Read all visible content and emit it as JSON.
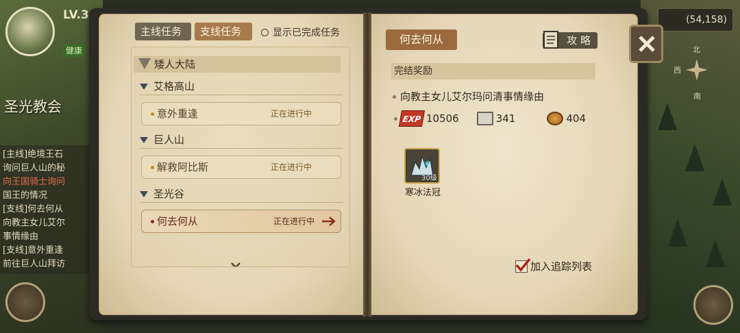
{
  "hud": {
    "level": "LV.3",
    "health_tag": "健康",
    "location_name": "圣光教会",
    "coords": "(54,158)",
    "compass": {
      "north": "北",
      "west": "西",
      "south": "南"
    },
    "quest_log": [
      "[主线]绝境王石",
      "询问巨人山的秘",
      "向王国骑士询问",
      "国王的情况",
      "[支线]何去何从",
      "向教主女儿艾尔",
      "事情缘由",
      "[支线]意外重逢",
      "前往巨人山拜访"
    ]
  },
  "tabs": {
    "main": "主线任务",
    "branch": "支线任务",
    "show_completed": "显示已完成任务"
  },
  "quests": {
    "region": "矮人大陆",
    "areas": [
      {
        "name": "艾格高山",
        "quest": "意外重逢",
        "status": "正在进行中"
      },
      {
        "name": "巨人山",
        "quest": "解救阿比斯",
        "status": "正在进行中"
      },
      {
        "name": "圣光谷",
        "quest": "何去何从",
        "status": "正在进行中"
      }
    ]
  },
  "detail": {
    "title": "何去何从",
    "guide_label": "攻 略",
    "reward_header": "完结奖励",
    "description": "向教主女儿艾尔玛问清事情缘由",
    "exp_label": "EXP",
    "exp": "10506",
    "book_reward": "341",
    "coin_reward": "404",
    "item_name": "寒冰法冠",
    "item_level": "30级",
    "track_label": "加入追踪列表"
  },
  "colors": {
    "accent": "#9b6a3e",
    "page": "#e8dcc0",
    "active_quest": "#6a2a18"
  }
}
